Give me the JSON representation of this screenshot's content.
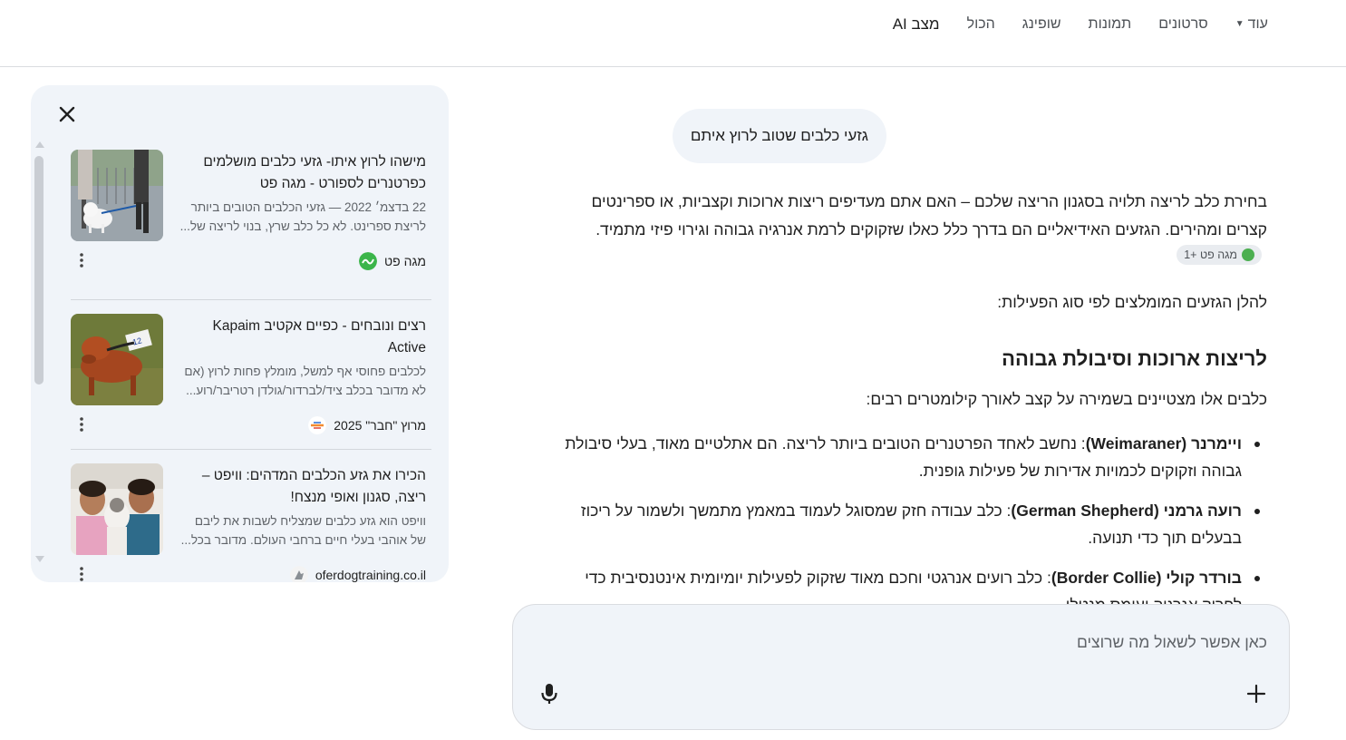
{
  "nav": {
    "tabs": [
      {
        "label": "מצב AI",
        "active": true
      },
      {
        "label": "הכול"
      },
      {
        "label": "שופינג"
      },
      {
        "label": "תמונות"
      },
      {
        "label": "סרטונים"
      },
      {
        "label": "עוד"
      }
    ]
  },
  "sources_panel": {
    "close_icon": "close-icon",
    "cards": [
      {
        "title": "מישהו לרוץ איתו- גזעי כלבים מושלמים כפרטנרים לספורט - מגה פט",
        "snippet": "22 בדצמ׳ 2022 — גזעי הכלבים הטובים ביותר לריצת ספרינט. לא כל כלב שרץ, בנוי לריצה של...",
        "source": "מגה פט",
        "favicon_color": "#3bb54a"
      },
      {
        "title": "רצים ונובחים - כפיים אקטיב Kapaim Active",
        "snippet": "לכלבים פחוסי אף למשל, מומלץ פחות לרוץ (אם לא מדובר בכלב ציד/לברדור/גולדן רטריבר/רוע...",
        "source": "מרוץ \"חבר\" 2025",
        "favicon_color": "#f28b30"
      },
      {
        "title": "הכירו את גזע הכלבים המדהים: וויפט – ריצה, סגנון ואופי מנצח!",
        "snippet": "וויפט הוא גזע כלבים שמצליח לשבות את ליבם של אוהבי בעלי חיים ברחבי העולם. מדובר בכל...",
        "source": "oferdogtraining.co.il",
        "favicon_color": "#9aa0a6"
      }
    ]
  },
  "main": {
    "query": "גזעי כלבים שטוב לרוץ איתם",
    "intro": "בחירת כלב לריצה תלויה בסגנון הריצה שלכם – האם אתם מעדיפים ריצות ארוכות וקצביות, או ספרינטים קצרים ומהירים. הגזעים האידיאליים הם בדרך כלל כאלו שזקוקים לרמת אנרגיה גבוהה וגירוי פיזי מתמיד.",
    "intro_chip": "מגה פט +1",
    "lead": "להלן הגזעים המומלצים לפי סוג הפעילות:",
    "section_heading": "לריצות ארוכות וסיבולת גבוהה",
    "section_intro": "כלבים אלו מצטיינים בשמירה על קצב לאורך קילומטרים רבים:",
    "breeds": [
      {
        "name": "ויימרנר (Weimaraner)",
        "desc": ": נחשב לאחד הפרטנרים הטובים ביותר לריצה. הם אתלטיים מאוד, בעלי סיבולת גבוהה וזקוקים לכמויות אדירות של פעילות גופנית."
      },
      {
        "name": "רועה גרמני (German Shepherd)",
        "desc": ": כלב עבודה חזק שמסוגל לעמוד במאמץ מתמשך ולשמור על ריכוז בבעלים תוך כדי תנועה."
      },
      {
        "name": "בורדר קולי (Border Collie)",
        "desc": ": כלב רועים אנרגטי וחכם מאוד שזקוק לפעילות יומיומית אינטנסיבית כדי לפרוק אנרגיה ועומס מנטלי."
      }
    ]
  },
  "input": {
    "placeholder": "כאן אפשר לשאול מה שרוצים",
    "mic_icon": "mic-icon",
    "plus_icon": "plus-icon"
  }
}
